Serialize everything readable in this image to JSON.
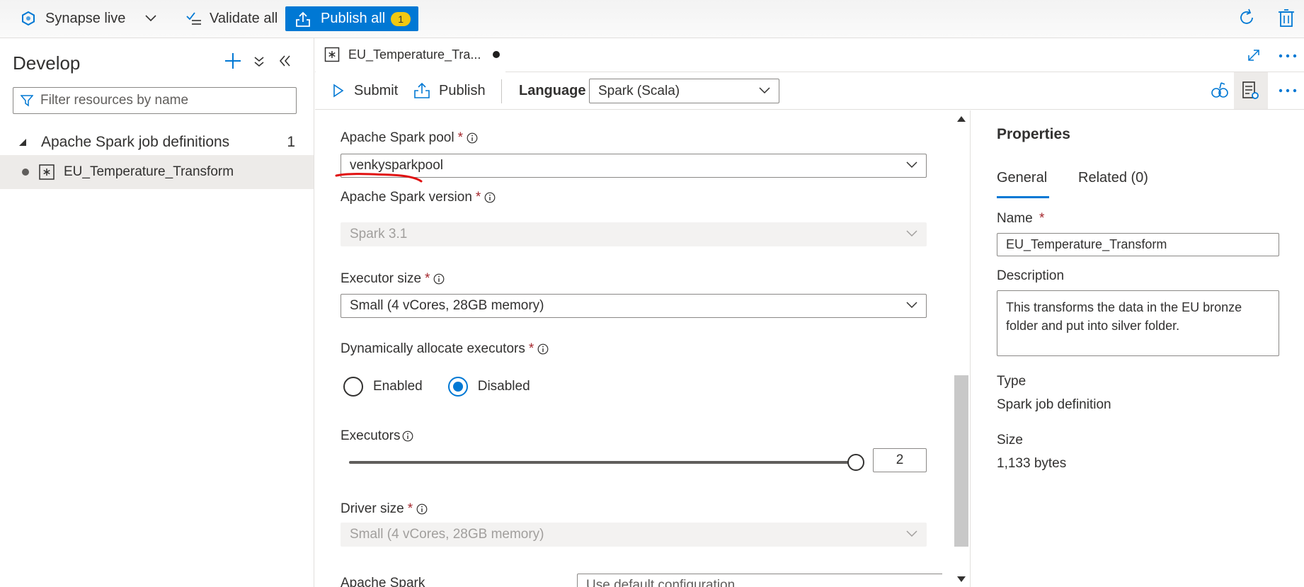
{
  "topbar": {
    "workspace_mode": "Synapse live",
    "validate_label": "Validate all",
    "publish_label": "Publish all",
    "publish_count": "1"
  },
  "develop": {
    "title": "Develop",
    "filter_placeholder": "Filter resources by name",
    "section_label": "Apache Spark job definitions",
    "section_count": "1",
    "items": [
      {
        "label": "EU_Temperature_Transform"
      }
    ]
  },
  "tab": {
    "label": "EU_Temperature_Tra..."
  },
  "toolbar": {
    "submit_label": "Submit",
    "publish_label": "Publish",
    "language_label": "Language",
    "language_value": "Spark (Scala)"
  },
  "form": {
    "spark_pool_label": "Apache Spark pool",
    "spark_pool_value": "venkysparkpool",
    "spark_version_label": "Apache Spark version",
    "spark_version_value": "Spark 3.1",
    "executor_size_label": "Executor size",
    "executor_size_value": "Small (4 vCores, 28GB memory)",
    "dynamic_alloc_label": "Dynamically allocate executors",
    "enabled_label": "Enabled",
    "disabled_label": "Disabled",
    "selected_allocation": "Disabled",
    "executors_label": "Executors",
    "executors_value": "2",
    "driver_size_label": "Driver size",
    "driver_size_value": "Small (4 vCores, 28GB memory)",
    "spark_config_label": "Apache Spark",
    "spark_config_value": "Use default configuration",
    "required_mark": "*"
  },
  "properties": {
    "title": "Properties",
    "tab_general": "General",
    "tab_related": "Related (0)",
    "name_label": "Name",
    "name_value": "EU_Temperature_Transform",
    "description_label": "Description",
    "description_value": "This transforms the data in the EU bronze folder and put into silver folder.",
    "type_label": "Type",
    "type_value": "Spark job definition",
    "size_label": "Size",
    "size_value": "1,133 bytes"
  },
  "colors": {
    "accent": "#0078d4",
    "badge": "#f2c811",
    "required": "#a4262c",
    "annotation_underline": "#e01010"
  }
}
